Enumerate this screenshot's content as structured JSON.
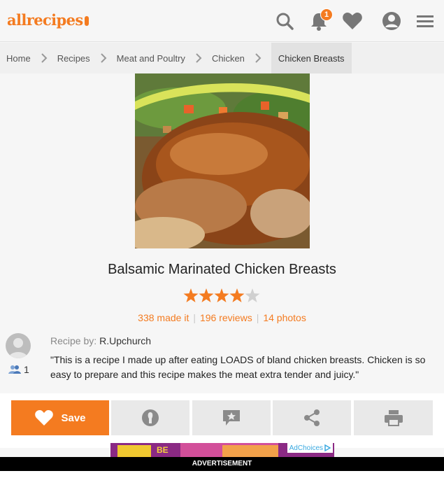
{
  "header": {
    "logo": "allrecipes",
    "notification_count": "1",
    "icons": [
      "search-icon",
      "bell-icon",
      "heart-icon",
      "user-icon",
      "menu-icon"
    ]
  },
  "breadcrumb": {
    "items": [
      "Home",
      "Recipes",
      "Meat and Poultry",
      "Chicken",
      "Chicken Breasts"
    ]
  },
  "recipe": {
    "title": "Balsamic Marinated Chicken Breasts",
    "rating": 4,
    "rating_max": 5,
    "made_it": "338 made it",
    "reviews": "196 reviews",
    "photos": "14 photos",
    "author_label": "Recipe by:",
    "author_name": "R.Upchurch",
    "followers": "1",
    "description": "\"This is a recipe I made up after eating LOADS of bland chicken breasts. Chicken is so easy to prepare and this recipe makes the meat extra tender and juicy.\""
  },
  "actions": {
    "save_label": "Save",
    "icons": [
      "heart-icon",
      "made-it-icon",
      "review-icon",
      "share-icon",
      "print-icon"
    ]
  },
  "ad": {
    "text": "BE",
    "adchoices": "AdChoices",
    "label": "ADVERTISEMENT"
  },
  "colors": {
    "brand": "#f47b20",
    "star_empty": "#d0d0d0",
    "button_bg": "#e9e9e9"
  }
}
